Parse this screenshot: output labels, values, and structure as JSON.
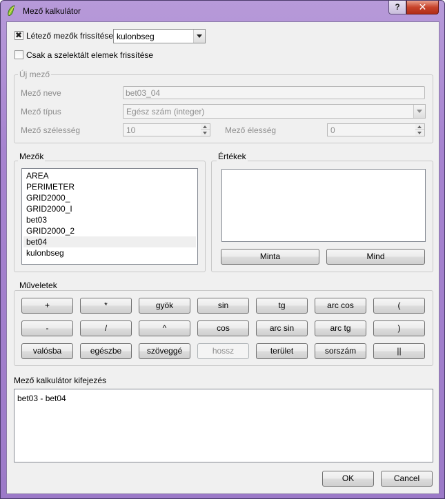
{
  "window": {
    "title": "Mező kalkulátor",
    "help": "?",
    "close": "✕"
  },
  "top": {
    "update_existing": {
      "label": "Létező mezők frissítése",
      "checked": true
    },
    "field_select": "kulonbseg",
    "only_selected": {
      "label": "Csak a szelektált elemek frissítése",
      "checked": false
    }
  },
  "new_field": {
    "title": "Új mező",
    "name_label": "Mező neve",
    "name_value": "bet03_04",
    "type_label": "Mező típus",
    "type_value": "Egész szám (integer)",
    "width_label": "Mező szélesség",
    "width_value": "10",
    "precision_label": "Mező élesség",
    "precision_value": "0"
  },
  "fields": {
    "title": "Mezők",
    "items": [
      "AREA",
      "PERIMETER",
      "GRID2000_",
      "GRID2000_I",
      "bet03",
      "GRID2000_2",
      "bet04",
      "kulonbseg"
    ],
    "highlighted": "bet04"
  },
  "values": {
    "title": "Értékek",
    "sample_button": "Minta",
    "all_button": "Mind"
  },
  "operators": {
    "title": "Műveletek",
    "rows": [
      [
        "+",
        "*",
        "gyök",
        "sin",
        "tg",
        "arc cos",
        "("
      ],
      [
        "-",
        "/",
        "^",
        "cos",
        "arc sin",
        "arc tg",
        ")"
      ],
      [
        "valósba",
        "egészbe",
        "szöveggé",
        "hossz",
        "terület",
        "sorszám",
        "||"
      ]
    ],
    "disabled": [
      "hossz"
    ]
  },
  "expression": {
    "label": "Mező kalkulátor kifejezés",
    "value": "bet03 - bet04"
  },
  "buttons": {
    "ok": "OK",
    "cancel": "Cancel"
  },
  "colors": {
    "title_gradient_top": "#b79ad9",
    "close_red": "#c7432b",
    "dialog_bg": "#f0f0f0"
  }
}
